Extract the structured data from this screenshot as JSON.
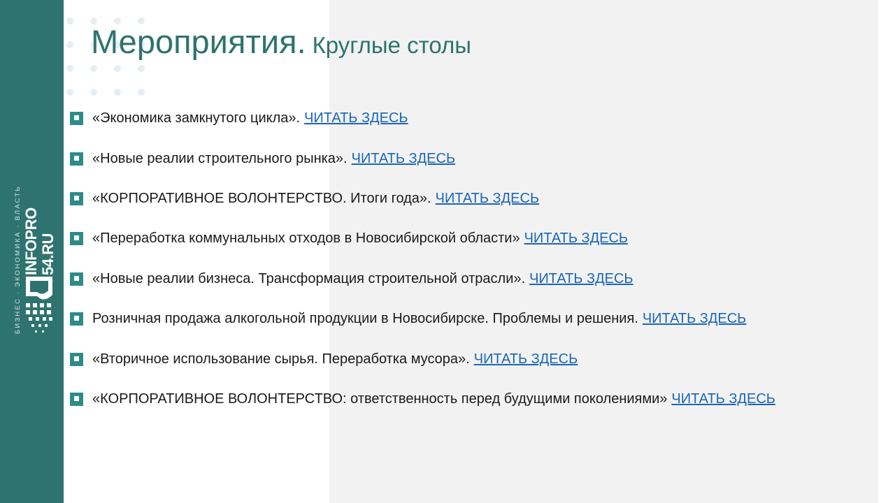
{
  "title": {
    "main": "Мероприятия.",
    "sub": "Круглые столы"
  },
  "sidebar": {
    "tagline": "БИЗНЕС · ЭКОНОМИКА · ВЛАСТЬ",
    "logo_line1": "INFOPRO",
    "logo_line2": "54.RU"
  },
  "items": [
    {
      "text": "«Экономика замкнутого цикла».",
      "link": "ЧИТАТЬ ЗДЕСЬ"
    },
    {
      "text": "«Новые реалии строительного рынка».",
      "link": "ЧИТАТЬ ЗДЕСЬ"
    },
    {
      "text": "«КОРПОРАТИВНОЕ ВОЛОНТЕРСТВО. Итоги года».",
      "link": "ЧИТАТЬ ЗДЕСЬ"
    },
    {
      "text": "«Переработка коммунальных отходов в Новосибирской области»",
      "link": "ЧИТАТЬ ЗДЕСЬ"
    },
    {
      "text": "«Новые реалии бизнеса. Трансформация строительной отрасли».",
      "link": "ЧИТАТЬ ЗДЕСЬ"
    },
    {
      "text": "Розничная продажа алкогольной продукции в Новосибирске. Проблемы и решения.",
      "link": "ЧИТАТЬ ЗДЕСЬ"
    },
    {
      "text": "«Вторичное использование сырья. Переработка мусора».",
      "link": "ЧИТАТЬ ЗДЕСЬ"
    },
    {
      "text": "«КОРПОРАТИВНОЕ ВОЛОНТЕРСТВО: ответственность перед будущими поколениями»",
      "link": "ЧИТАТЬ ЗДЕСЬ"
    }
  ],
  "colors": {
    "accent": "#2e7370",
    "bullet": "#2e8b87",
    "link": "#1a66b8",
    "panel": "#f2f2f2"
  },
  "icons": {
    "bullet": "square-bullet-icon",
    "logo": "infopro-logo-mark"
  }
}
